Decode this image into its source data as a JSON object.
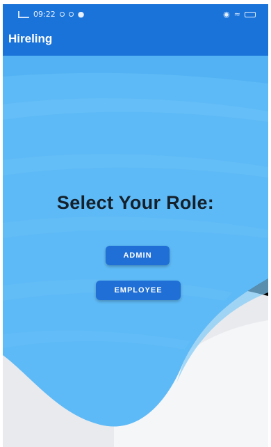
{
  "status_bar": {
    "time": "09:22"
  },
  "app_bar": {
    "title": "Hireling"
  },
  "main": {
    "heading": "Select Your Role:",
    "buttons": [
      {
        "label": "ADMIN"
      },
      {
        "label": "EMPLOYEE"
      }
    ]
  },
  "colors": {
    "primary": "#1a73d9",
    "sky": "#5ebaf6",
    "button": "#1f6fd6",
    "heading": "#14202b"
  },
  "icons": [
    "signal-icon",
    "location-icon",
    "search-icon",
    "notification-icon",
    "vibrate-icon",
    "wifi-icon",
    "battery-icon"
  ]
}
